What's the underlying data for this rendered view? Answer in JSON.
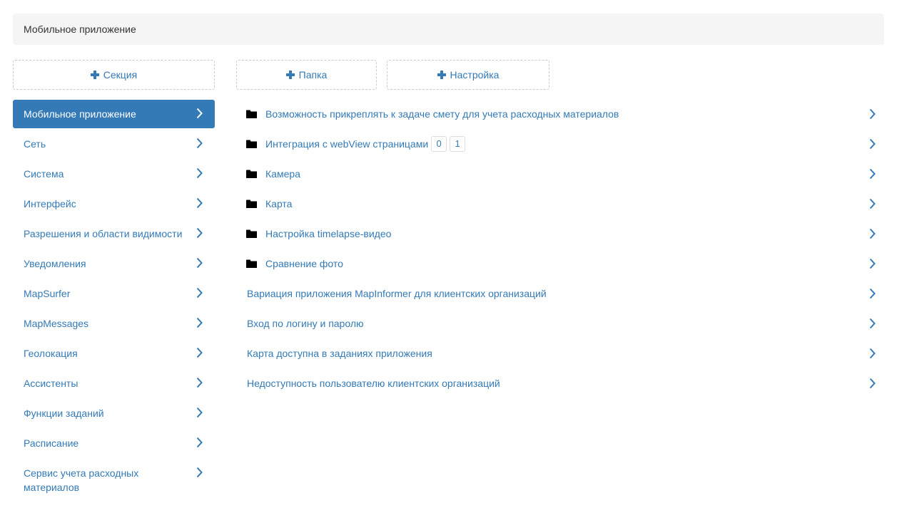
{
  "breadcrumb": {
    "title": "Мобильное приложение"
  },
  "buttons": {
    "add_section": "Секция",
    "add_folder": "Папка",
    "add_setting": "Настройка"
  },
  "sidebar": {
    "items": [
      {
        "label": "Мобильное приложение",
        "active": true
      },
      {
        "label": "Сеть"
      },
      {
        "label": "Система"
      },
      {
        "label": "Интерфейс"
      },
      {
        "label": "Разрешения и области видимости"
      },
      {
        "label": "Уведомления"
      },
      {
        "label": "MapSurfer"
      },
      {
        "label": "MapMessages"
      },
      {
        "label": "Геолокация"
      },
      {
        "label": "Ассистенты"
      },
      {
        "label": "Функции заданий"
      },
      {
        "label": "Расписание"
      },
      {
        "label": "Сервис учета расходных материалов"
      }
    ]
  },
  "main": {
    "folders": [
      {
        "label": "Возможность прикреплять к задаче смету для учета расходных материалов"
      },
      {
        "label": "Интеграция с webView страницами",
        "badges": [
          "0",
          "1"
        ]
      },
      {
        "label": "Камера"
      },
      {
        "label": "Карта"
      },
      {
        "label": "Настройка timelapse-видео"
      },
      {
        "label": "Сравнение фото"
      }
    ],
    "settings": [
      {
        "label": "Вариация приложения MapInformer для клиентских организаций"
      },
      {
        "label": "Вход по логину и паролю"
      },
      {
        "label": "Карта доступна в заданиях приложения"
      },
      {
        "label": "Недоступность пользователю клиентских организаций"
      }
    ]
  },
  "icons": {
    "plus": "plus-icon",
    "folder": "folder-icon",
    "chevron": "chevron-right-icon"
  },
  "colors": {
    "accent": "#337ab7",
    "breadcrumb_bg": "#f5f5f5",
    "text": "#333333"
  }
}
